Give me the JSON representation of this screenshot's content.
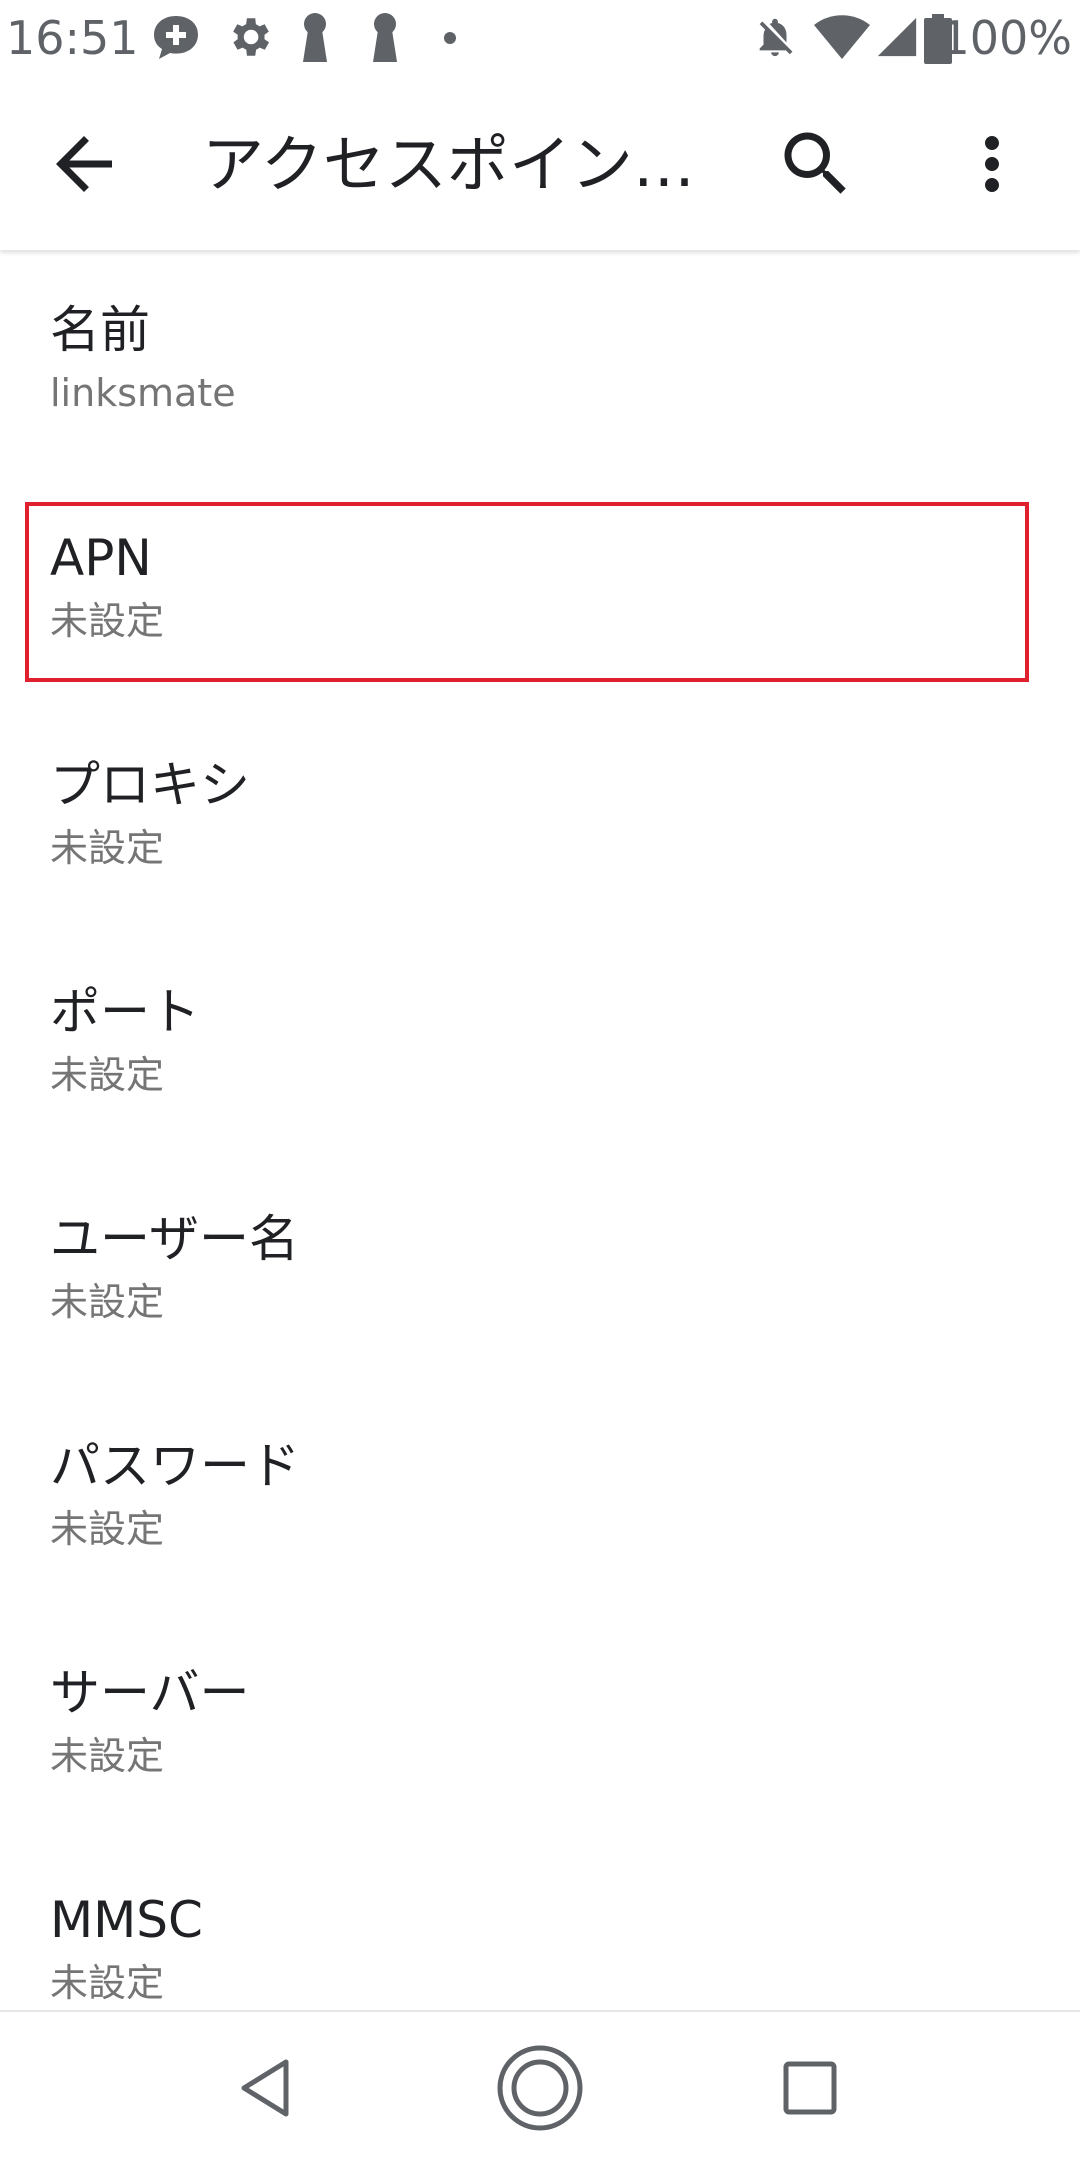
{
  "status_bar": {
    "time": "16:51",
    "left_icons": [
      "chat-plus-icon",
      "gear-icon",
      "keyhole-icon",
      "keyhole-icon",
      "dot-icon"
    ],
    "right_icons": [
      "bell-off-icon",
      "wifi-icon",
      "cellular-signal-icon",
      "battery-icon"
    ],
    "battery_percent": "100%"
  },
  "app_bar": {
    "back_icon": "arrow-back-icon",
    "title": "アクセスポイン…",
    "search_icon": "search-icon",
    "more_icon": "more-vert-icon"
  },
  "settings": {
    "items": [
      {
        "title": "名前",
        "summary": "linksmate"
      },
      {
        "title": "APN",
        "summary": "未設定"
      },
      {
        "title": "プロキシ",
        "summary": "未設定"
      },
      {
        "title": "ポート",
        "summary": "未設定"
      },
      {
        "title": "ユーザー名",
        "summary": "未設定"
      },
      {
        "title": "パスワード",
        "summary": "未設定"
      },
      {
        "title": "サーバー",
        "summary": "未設定"
      },
      {
        "title": "MMSC",
        "summary": "未設定"
      }
    ],
    "highlighted_item": "APN"
  },
  "colors": {
    "highlight": "#e0202e",
    "text_primary": "#202124",
    "text_secondary": "#757575",
    "status_icons": "#5f6368"
  },
  "nav_bar": {
    "back": "nav-back-icon",
    "home": "nav-home-icon",
    "recents": "nav-recents-icon"
  }
}
